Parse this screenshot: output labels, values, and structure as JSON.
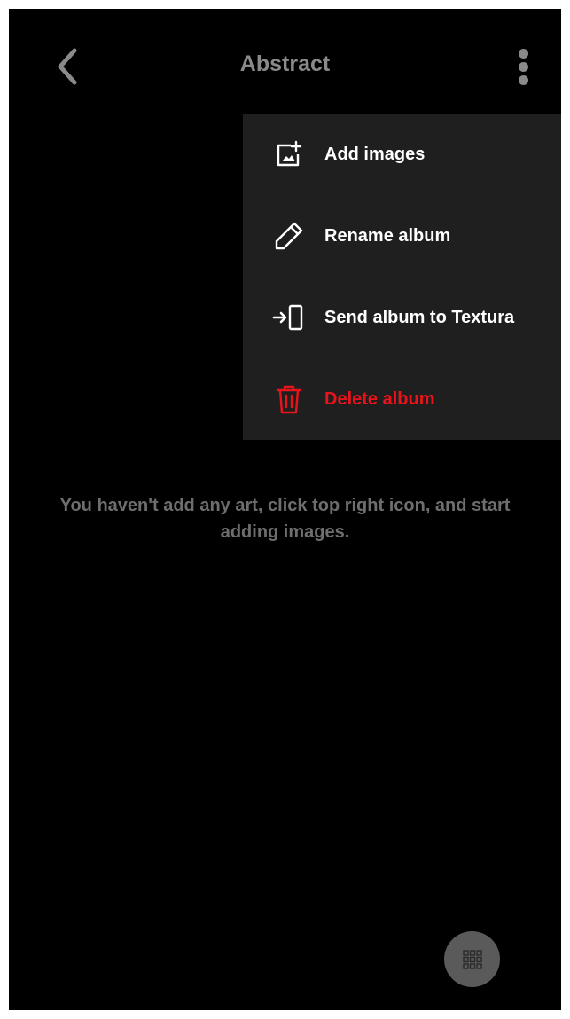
{
  "header": {
    "title": "Abstract",
    "back_icon": "chevron-left-icon",
    "more_icon": "more-vertical-icon"
  },
  "menu": {
    "items": [
      {
        "label": "Add images",
        "icon": "add-image-icon"
      },
      {
        "label": "Rename album",
        "icon": "pencil-icon"
      },
      {
        "label": "Send album to Textura",
        "icon": "send-to-device-icon"
      },
      {
        "label": "Delete album",
        "icon": "trash-icon"
      }
    ]
  },
  "main": {
    "empty_message": "You haven't add any art, click top right icon, and start adding images."
  },
  "fab": {
    "icon": "grid-icon"
  },
  "colors": {
    "background": "#000000",
    "menu_background": "#1f1f1f",
    "muted_text": "#8a8a8a",
    "danger": "#e8141c",
    "fab": "#5a5a5a"
  }
}
